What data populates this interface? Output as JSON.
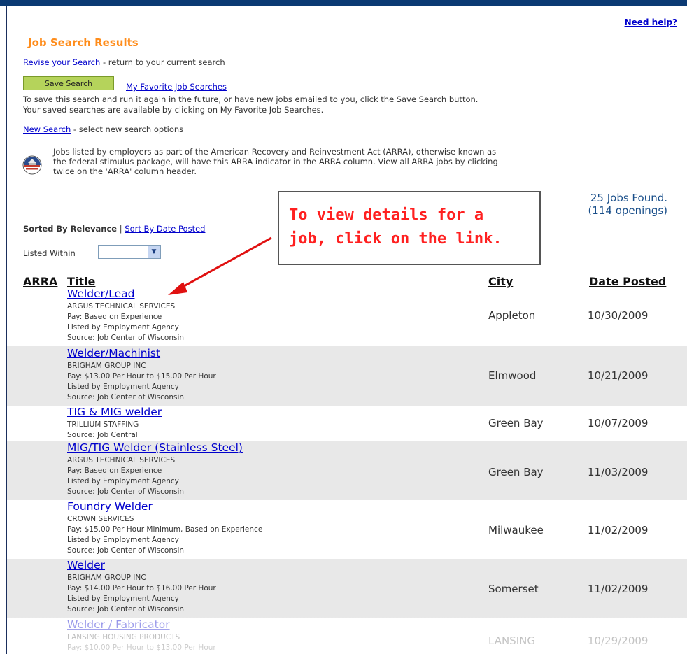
{
  "help_link": "Need help?",
  "page_title": "Job Search Results",
  "revise": {
    "link": "Revise your Search ",
    "text": " - return to your current search"
  },
  "save": {
    "button": "Save Search",
    "favorites_link": "My Favorite Job Searches",
    "desc1": "To save this search and run it again in the future, or have new jobs emailed to you, click the Save Search button.",
    "desc2": "Your saved searches are available by clicking on My Favorite Job Searches."
  },
  "new_search": {
    "link": "New Search",
    "text": "  - select new search options"
  },
  "arra_note": {
    "line1": "Jobs listed by employers as part of the American Recovery and Reinvestment Act (ARRA), otherwise known as",
    "line2": "the federal stimulus package, will have this ARRA indicator in the ARRA column. View all ARRA jobs by clicking",
    "line3": "twice on the 'ARRA' column header."
  },
  "results_count": {
    "jobs": "25 Jobs Found.",
    "openings": "(114 openings)"
  },
  "sort": {
    "current": "Sorted By Relevance",
    "separator": " | ",
    "alt_link": "Sort By Date Posted"
  },
  "filter": {
    "label": "Listed Within",
    "value": ""
  },
  "callout": {
    "line1": "To view details for a",
    "line2": "job, click on the link."
  },
  "columns": {
    "arra": "ARRA",
    "title": "Title",
    "city": "City",
    "date": "Date Posted"
  },
  "jobs": [
    {
      "title": "Welder/Lead",
      "employer": "ARGUS TECHNICAL SERVICES",
      "details": [
        "Pay: Based on Experience",
        "Listed by Employment Agency",
        "Source: Job Center of Wisconsin"
      ],
      "city": "Appleton",
      "date": "10/30/2009"
    },
    {
      "title": "Welder/Machinist",
      "employer": "BRIGHAM GROUP INC",
      "details": [
        "Pay: $13.00 Per Hour to $15.00 Per Hour",
        "Listed by Employment Agency",
        "Source: Job Center of Wisconsin"
      ],
      "city": "Elmwood",
      "date": "10/21/2009"
    },
    {
      "title": "TIG & MIG welder",
      "employer": "TRILLIUM STAFFING",
      "details": [
        "Source: Job Central"
      ],
      "city": "Green Bay",
      "date": "10/07/2009"
    },
    {
      "title": "MIG/TIG Welder (Stainless Steel)",
      "employer": "ARGUS TECHNICAL SERVICES",
      "details": [
        "Pay: Based on Experience",
        "Listed by Employment Agency",
        "Source: Job Center of Wisconsin"
      ],
      "city": "Green Bay",
      "date": "11/03/2009"
    },
    {
      "title": "Foundry Welder",
      "employer": "CROWN SERVICES",
      "details": [
        "Pay: $15.00 Per Hour Minimum, Based on Experience",
        "Listed by Employment Agency",
        "Source: Job Center of Wisconsin"
      ],
      "city": "Milwaukee",
      "date": "11/02/2009"
    },
    {
      "title": "Welder",
      "employer": "BRIGHAM GROUP INC",
      "details": [
        "Pay: $14.00 Per Hour to $16.00 Per Hour",
        "Listed by Employment Agency",
        "Source: Job Center of Wisconsin"
      ],
      "city": "Somerset",
      "date": "11/02/2009"
    },
    {
      "title": "Welder / Fabricator",
      "employer": "LANSING HOUSING PRODUCTS",
      "details": [
        "Pay: $10.00 Per Hour to $13.00 Per Hour"
      ],
      "city": "LANSING",
      "date": "10/29/2009"
    }
  ]
}
